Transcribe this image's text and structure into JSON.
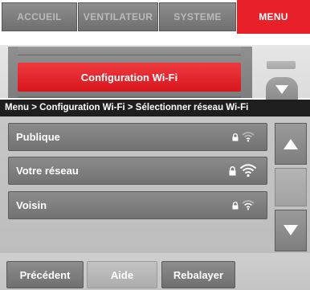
{
  "tabs": [
    {
      "label": "ACCUEIL",
      "active": false
    },
    {
      "label": "VENTILATEUR",
      "active": false
    },
    {
      "label": "SYSTEME",
      "active": false
    },
    {
      "label": "MENU",
      "active": true
    }
  ],
  "menu_panel": {
    "selected_item": "Configuration Wi-Fi",
    "scroll_icon": "triangle-down-icon"
  },
  "wifi_panel": {
    "breadcrumb": "Menu > Configuration Wi-Fi > Sélectionner réseau Wi-Fi",
    "networks": [
      {
        "name": "Publique",
        "secured": true,
        "signal": "low"
      },
      {
        "name": "Votre réseau",
        "secured": true,
        "signal": "strong"
      },
      {
        "name": "Voisin",
        "secured": true,
        "signal": "low"
      }
    ],
    "scroll_up_icon": "triangle-up-icon",
    "scroll_down_icon": "triangle-down-icon",
    "buttons": {
      "previous": "Précédent",
      "help": "Aide",
      "rescan": "Rebalayer"
    }
  },
  "colors": {
    "accent_red": "#e8202a",
    "breadcrumb_bg": "#1e1e1e"
  }
}
